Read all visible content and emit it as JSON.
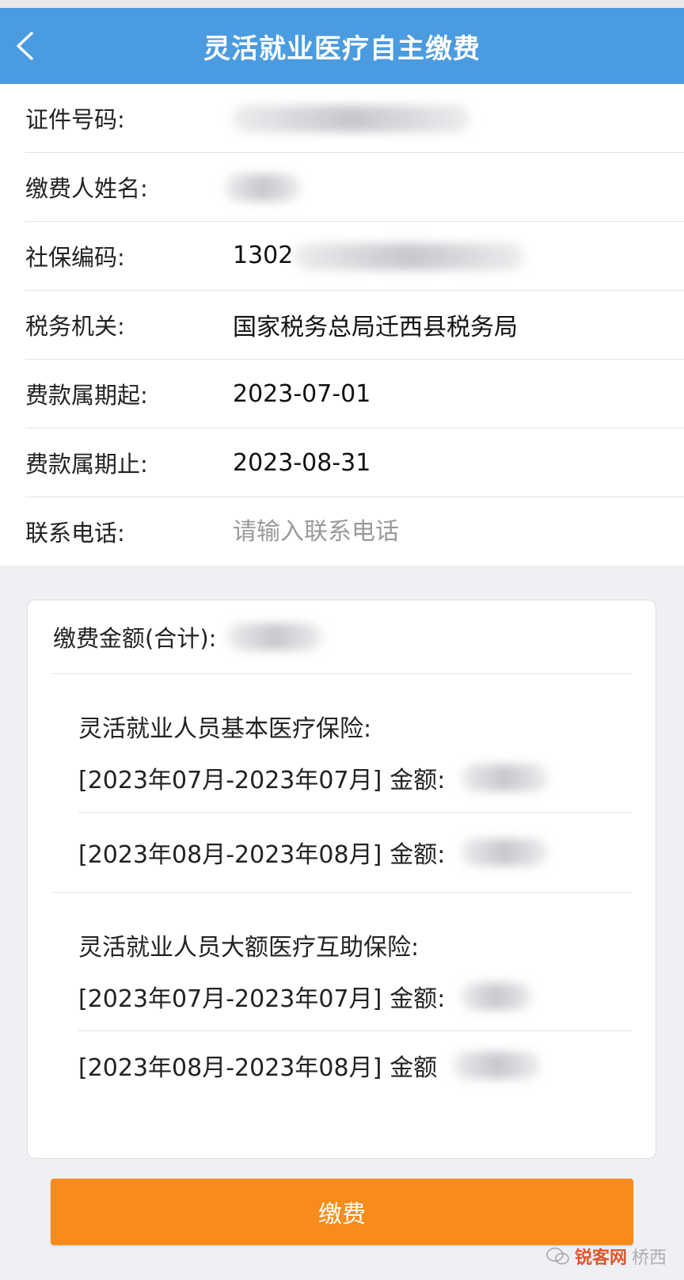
{
  "header": {
    "title": "灵活就业医疗自主缴费"
  },
  "form": {
    "id_number": {
      "label": "证件号码:",
      "value": ""
    },
    "payer_name": {
      "label": "缴费人姓名:",
      "value": ""
    },
    "social_code": {
      "label": "社保编码:",
      "value": "1302"
    },
    "tax_office": {
      "label": "税务机关:",
      "value": "国家税务总局迁西县税务局"
    },
    "period_start": {
      "label": "费款属期起:",
      "value": "2023-07-01"
    },
    "period_end": {
      "label": "费款属期止:",
      "value": "2023-08-31"
    },
    "contact_phone": {
      "label": "联系电话:",
      "value": "",
      "placeholder": "请输入联系电话"
    }
  },
  "summary": {
    "total_label": "缴费金额(合计):",
    "sections": [
      {
        "title": "灵活就业人员基本医疗保险:",
        "lines": [
          {
            "period": "[2023年07月-2023年07月]",
            "amount_label": "金额:"
          },
          {
            "period": "[2023年08月-2023年08月]",
            "amount_label": "金额:"
          }
        ]
      },
      {
        "title": "灵活就业人员大额医疗互助保险:",
        "lines": [
          {
            "period": "[2023年07月-2023年07月]",
            "amount_label": "金额:"
          },
          {
            "period": "[2023年08月-2023年08月]",
            "amount_label": "金额"
          }
        ]
      }
    ]
  },
  "actions": {
    "pay_label": "缴费"
  },
  "watermark": {
    "brand": "锐客网",
    "text": "桥西"
  },
  "colors": {
    "header": "#4a9be0",
    "button": "#f88c1a"
  }
}
